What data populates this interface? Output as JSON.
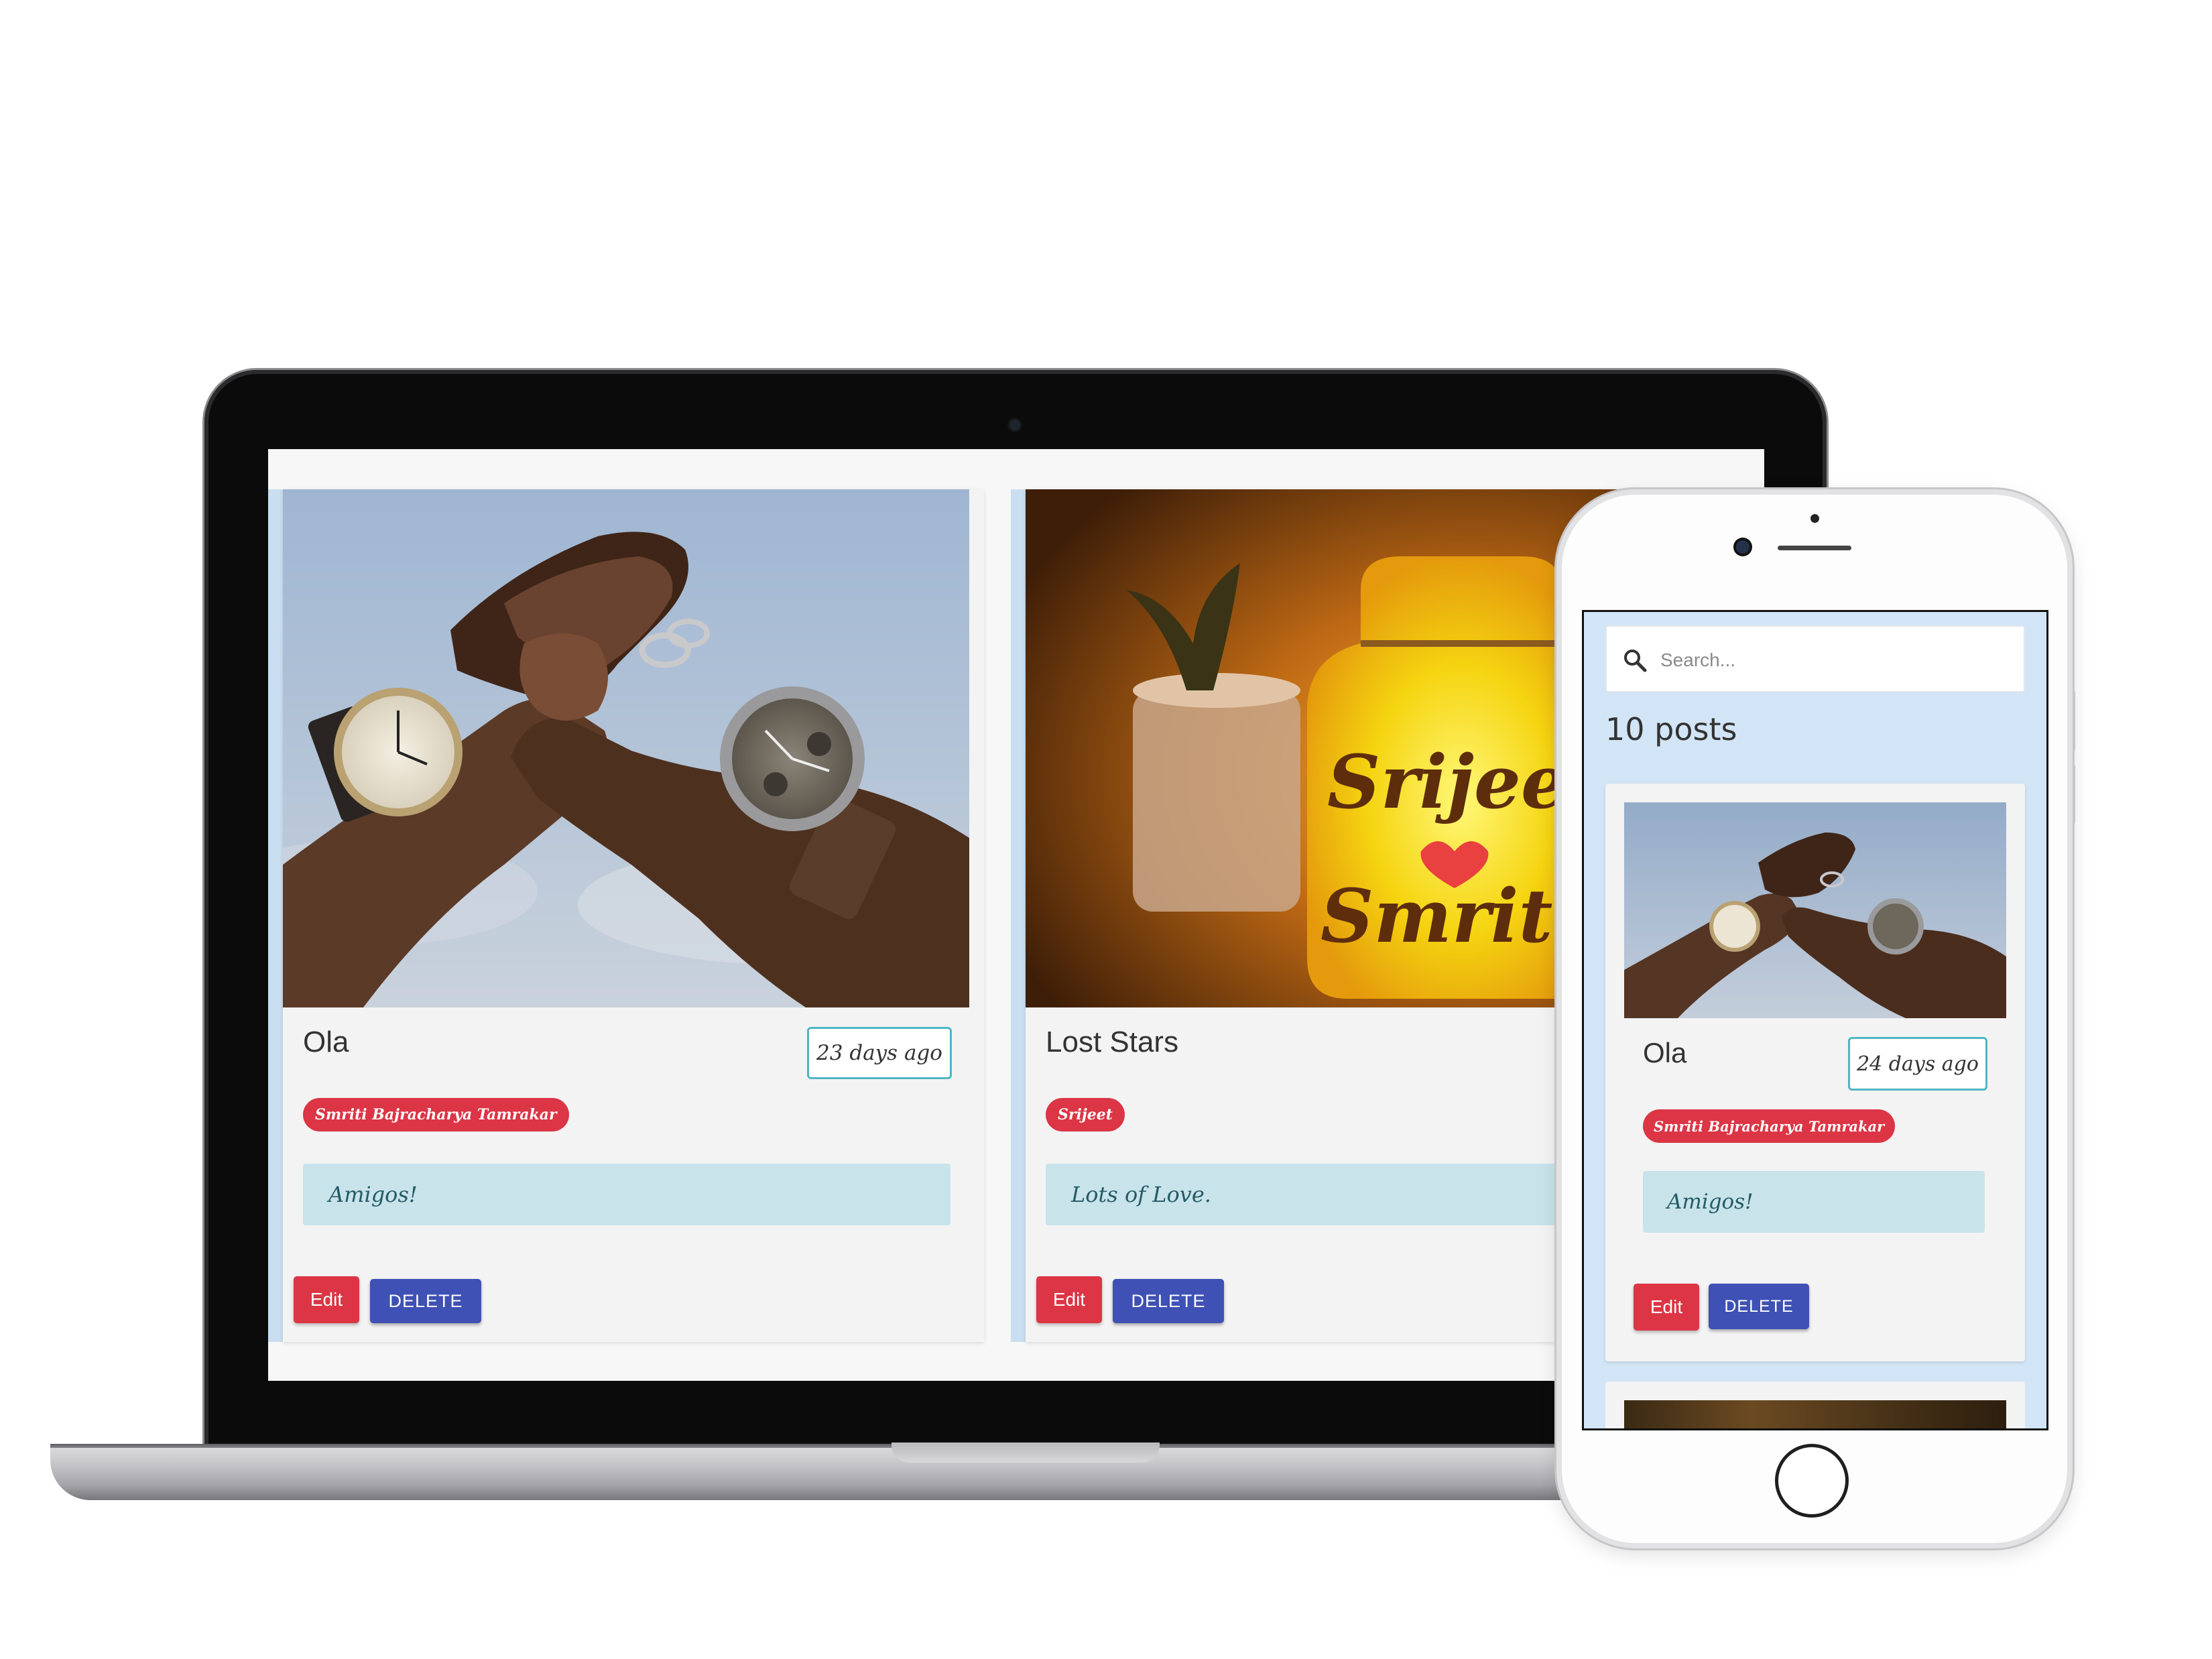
{
  "desktop": {
    "posts": [
      {
        "title": "Ola",
        "date": "23 days ago",
        "author": "Smriti Bajracharya Tamrakar",
        "message": "Amigos!",
        "edit_label": "Edit",
        "delete_label": "DELETE"
      },
      {
        "title": "Lost Stars",
        "date": "",
        "author": "Srijeet",
        "message": "Lots of Love.",
        "edit_label": "Edit",
        "delete_label": "DELETE"
      }
    ],
    "photo_text": {
      "line1": "Srijeet",
      "line2": "Smriti"
    }
  },
  "mobile": {
    "search": {
      "placeholder": "Search..."
    },
    "posts_count": "10 posts",
    "posts": [
      {
        "title": "Ola",
        "date": "24 days ago",
        "author": "Smriti Bajracharya Tamrakar",
        "message": "Amigos!",
        "edit_label": "Edit",
        "delete_label": "DELETE"
      }
    ]
  },
  "colors": {
    "tag_red": "#dc3545",
    "delete_blue": "#3f51b5",
    "date_border": "#4fb6c4",
    "message_bg": "#c8e3ea",
    "page_bg_blue": "#d2e5f6"
  },
  "icons": [
    "search-icon"
  ]
}
